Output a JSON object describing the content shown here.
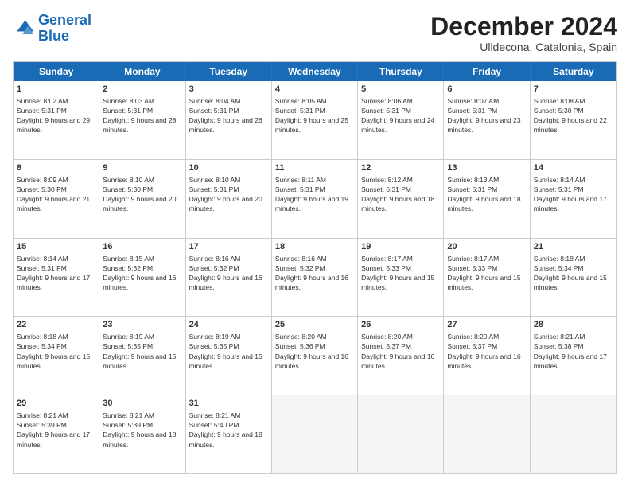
{
  "header": {
    "logo_line1": "General",
    "logo_line2": "Blue",
    "month_title": "December 2024",
    "location": "Ulldecona, Catalonia, Spain"
  },
  "weekdays": [
    "Sunday",
    "Monday",
    "Tuesday",
    "Wednesday",
    "Thursday",
    "Friday",
    "Saturday"
  ],
  "rows": [
    [
      {
        "day": "1",
        "sunrise": "Sunrise: 8:02 AM",
        "sunset": "Sunset: 5:31 PM",
        "daylight": "Daylight: 9 hours and 29 minutes."
      },
      {
        "day": "2",
        "sunrise": "Sunrise: 8:03 AM",
        "sunset": "Sunset: 5:31 PM",
        "daylight": "Daylight: 9 hours and 28 minutes."
      },
      {
        "day": "3",
        "sunrise": "Sunrise: 8:04 AM",
        "sunset": "Sunset: 5:31 PM",
        "daylight": "Daylight: 9 hours and 26 minutes."
      },
      {
        "day": "4",
        "sunrise": "Sunrise: 8:05 AM",
        "sunset": "Sunset: 5:31 PM",
        "daylight": "Daylight: 9 hours and 25 minutes."
      },
      {
        "day": "5",
        "sunrise": "Sunrise: 8:06 AM",
        "sunset": "Sunset: 5:31 PM",
        "daylight": "Daylight: 9 hours and 24 minutes."
      },
      {
        "day": "6",
        "sunrise": "Sunrise: 8:07 AM",
        "sunset": "Sunset: 5:31 PM",
        "daylight": "Daylight: 9 hours and 23 minutes."
      },
      {
        "day": "7",
        "sunrise": "Sunrise: 8:08 AM",
        "sunset": "Sunset: 5:30 PM",
        "daylight": "Daylight: 9 hours and 22 minutes."
      }
    ],
    [
      {
        "day": "8",
        "sunrise": "Sunrise: 8:09 AM",
        "sunset": "Sunset: 5:30 PM",
        "daylight": "Daylight: 9 hours and 21 minutes."
      },
      {
        "day": "9",
        "sunrise": "Sunrise: 8:10 AM",
        "sunset": "Sunset: 5:30 PM",
        "daylight": "Daylight: 9 hours and 20 minutes."
      },
      {
        "day": "10",
        "sunrise": "Sunrise: 8:10 AM",
        "sunset": "Sunset: 5:31 PM",
        "daylight": "Daylight: 9 hours and 20 minutes."
      },
      {
        "day": "11",
        "sunrise": "Sunrise: 8:11 AM",
        "sunset": "Sunset: 5:31 PM",
        "daylight": "Daylight: 9 hours and 19 minutes."
      },
      {
        "day": "12",
        "sunrise": "Sunrise: 8:12 AM",
        "sunset": "Sunset: 5:31 PM",
        "daylight": "Daylight: 9 hours and 18 minutes."
      },
      {
        "day": "13",
        "sunrise": "Sunrise: 8:13 AM",
        "sunset": "Sunset: 5:31 PM",
        "daylight": "Daylight: 9 hours and 18 minutes."
      },
      {
        "day": "14",
        "sunrise": "Sunrise: 8:14 AM",
        "sunset": "Sunset: 5:31 PM",
        "daylight": "Daylight: 9 hours and 17 minutes."
      }
    ],
    [
      {
        "day": "15",
        "sunrise": "Sunrise: 8:14 AM",
        "sunset": "Sunset: 5:31 PM",
        "daylight": "Daylight: 9 hours and 17 minutes."
      },
      {
        "day": "16",
        "sunrise": "Sunrise: 8:15 AM",
        "sunset": "Sunset: 5:32 PM",
        "daylight": "Daylight: 9 hours and 16 minutes."
      },
      {
        "day": "17",
        "sunrise": "Sunrise: 8:16 AM",
        "sunset": "Sunset: 5:32 PM",
        "daylight": "Daylight: 9 hours and 16 minutes."
      },
      {
        "day": "18",
        "sunrise": "Sunrise: 8:16 AM",
        "sunset": "Sunset: 5:32 PM",
        "daylight": "Daylight: 9 hours and 16 minutes."
      },
      {
        "day": "19",
        "sunrise": "Sunrise: 8:17 AM",
        "sunset": "Sunset: 5:33 PM",
        "daylight": "Daylight: 9 hours and 15 minutes."
      },
      {
        "day": "20",
        "sunrise": "Sunrise: 8:17 AM",
        "sunset": "Sunset: 5:33 PM",
        "daylight": "Daylight: 9 hours and 15 minutes."
      },
      {
        "day": "21",
        "sunrise": "Sunrise: 8:18 AM",
        "sunset": "Sunset: 5:34 PM",
        "daylight": "Daylight: 9 hours and 15 minutes."
      }
    ],
    [
      {
        "day": "22",
        "sunrise": "Sunrise: 8:18 AM",
        "sunset": "Sunset: 5:34 PM",
        "daylight": "Daylight: 9 hours and 15 minutes."
      },
      {
        "day": "23",
        "sunrise": "Sunrise: 8:19 AM",
        "sunset": "Sunset: 5:35 PM",
        "daylight": "Daylight: 9 hours and 15 minutes."
      },
      {
        "day": "24",
        "sunrise": "Sunrise: 8:19 AM",
        "sunset": "Sunset: 5:35 PM",
        "daylight": "Daylight: 9 hours and 15 minutes."
      },
      {
        "day": "25",
        "sunrise": "Sunrise: 8:20 AM",
        "sunset": "Sunset: 5:36 PM",
        "daylight": "Daylight: 9 hours and 16 minutes."
      },
      {
        "day": "26",
        "sunrise": "Sunrise: 8:20 AM",
        "sunset": "Sunset: 5:37 PM",
        "daylight": "Daylight: 9 hours and 16 minutes."
      },
      {
        "day": "27",
        "sunrise": "Sunrise: 8:20 AM",
        "sunset": "Sunset: 5:37 PM",
        "daylight": "Daylight: 9 hours and 16 minutes."
      },
      {
        "day": "28",
        "sunrise": "Sunrise: 8:21 AM",
        "sunset": "Sunset: 5:38 PM",
        "daylight": "Daylight: 9 hours and 17 minutes."
      }
    ],
    [
      {
        "day": "29",
        "sunrise": "Sunrise: 8:21 AM",
        "sunset": "Sunset: 5:39 PM",
        "daylight": "Daylight: 9 hours and 17 minutes."
      },
      {
        "day": "30",
        "sunrise": "Sunrise: 8:21 AM",
        "sunset": "Sunset: 5:39 PM",
        "daylight": "Daylight: 9 hours and 18 minutes."
      },
      {
        "day": "31",
        "sunrise": "Sunrise: 8:21 AM",
        "sunset": "Sunset: 5:40 PM",
        "daylight": "Daylight: 9 hours and 18 minutes."
      },
      null,
      null,
      null,
      null
    ]
  ]
}
